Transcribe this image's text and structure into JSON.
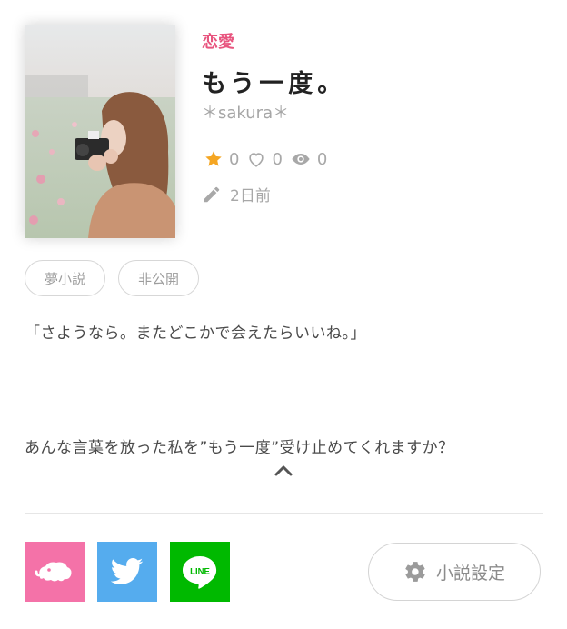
{
  "work": {
    "genre": "恋愛",
    "title": "もう一度。",
    "author": "＊sakura＊",
    "stats": {
      "stars": "0",
      "likes": "0",
      "views": "0"
    },
    "updated": "2日前"
  },
  "tags": [
    "夢小説",
    "非公開"
  ],
  "description": {
    "line1": "「さようなら。またどこかで会えたらいいね。」",
    "line2": "あんな言葉を放った私を”もう一度”受け止めてくれますか？"
  },
  "share": {
    "line_label": "LINE"
  },
  "settings_button": {
    "label": "小説設定"
  },
  "colors": {
    "genre": "#e8557f",
    "estar": "#f472a8",
    "twitter": "#55acee",
    "line": "#00b900",
    "star": "#f5a623"
  }
}
